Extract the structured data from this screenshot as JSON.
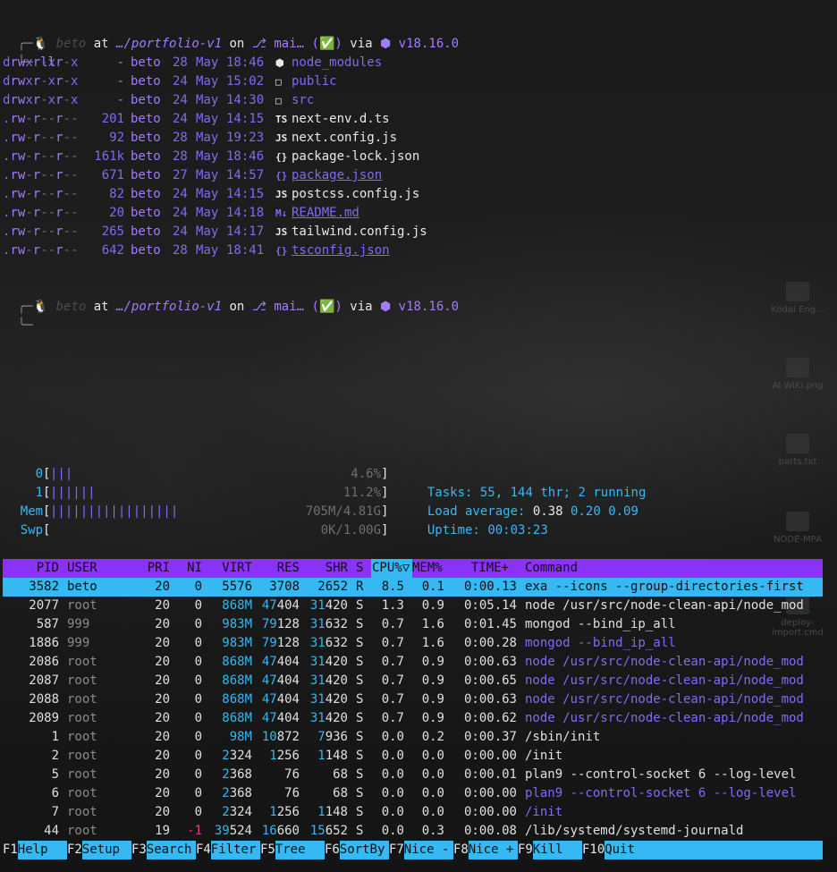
{
  "prompt": {
    "symbol": "╰─",
    "user": "beto",
    "at": "at",
    "path": "…/portfolio-v1",
    "on": "on",
    "branch_icon": "⎇",
    "branch": "mai…",
    "status": "(✅)",
    "via": "via",
    "node_version": "v18.16.0",
    "command": "ll"
  },
  "listing": [
    {
      "perm": "drwxr-xr-x",
      "size": "-",
      "user": "beto",
      "day": "28",
      "month": "May",
      "time": "18:46",
      "icon": "⬢",
      "name": "node_modules",
      "link": false,
      "color": "#7f6cf2"
    },
    {
      "perm": "drwxr-xr-x",
      "size": "-",
      "user": "beto",
      "day": "24",
      "month": "May",
      "time": "15:02",
      "icon": "□",
      "name": "public",
      "link": false,
      "color": "#7f6cf2"
    },
    {
      "perm": "drwxr-xr-x",
      "size": "-",
      "user": "beto",
      "day": "24",
      "month": "May",
      "time": "14:30",
      "icon": "□",
      "name": "src",
      "link": false,
      "color": "#7f6cf2"
    },
    {
      "perm": ".rw-r--r--",
      "size": "201",
      "user": "beto",
      "day": "24",
      "month": "May",
      "time": "14:15",
      "icon": "TS",
      "name": "next-env.d.ts",
      "link": false,
      "color": "#e8e8e8"
    },
    {
      "perm": ".rw-r--r--",
      "size": "92",
      "user": "beto",
      "day": "28",
      "month": "May",
      "time": "19:23",
      "icon": "JS",
      "name": "next.config.js",
      "link": false,
      "color": "#e8e8e8"
    },
    {
      "perm": ".rw-r--r--",
      "size": "161k",
      "user": "beto",
      "day": "28",
      "month": "May",
      "time": "18:46",
      "icon": "{}",
      "name": "package-lock.json",
      "link": false,
      "color": "#e8e8e8"
    },
    {
      "perm": ".rw-r--r--",
      "size": "671",
      "user": "beto",
      "day": "27",
      "month": "May",
      "time": "14:57",
      "icon": "{}",
      "name": "package.json",
      "link": true,
      "color": "#7f6cf2"
    },
    {
      "perm": ".rw-r--r--",
      "size": "82",
      "user": "beto",
      "day": "24",
      "month": "May",
      "time": "14:15",
      "icon": "JS",
      "name": "postcss.config.js",
      "link": false,
      "color": "#e8e8e8"
    },
    {
      "perm": ".rw-r--r--",
      "size": "20",
      "user": "beto",
      "day": "24",
      "month": "May",
      "time": "14:18",
      "icon": "M↓",
      "name": "README.md",
      "link": true,
      "color": "#7f6cf2"
    },
    {
      "perm": ".rw-r--r--",
      "size": "265",
      "user": "beto",
      "day": "24",
      "month": "May",
      "time": "14:17",
      "icon": "JS",
      "name": "tailwind.config.js",
      "link": false,
      "color": "#e8e8e8"
    },
    {
      "perm": ".rw-r--r--",
      "size": "642",
      "user": "beto",
      "day": "28",
      "month": "May",
      "time": "18:41",
      "icon": "{}",
      "name": "tsconfig.json",
      "link": true,
      "color": "#7f6cf2"
    }
  ],
  "htop": {
    "meters": [
      {
        "label": "0",
        "bars": "|||",
        "value": "4.6%"
      },
      {
        "label": "1",
        "bars": "||||||",
        "value": "11.2%"
      },
      {
        "label": "Mem",
        "bars": "|||||||||||||||||",
        "value": "705M/4.81G"
      },
      {
        "label": "Swp",
        "bars": "",
        "value": "0K/1.00G"
      }
    ],
    "tasks_label": "Tasks:",
    "tasks": "55,",
    "thr": "144",
    "thr_label": "thr;",
    "running": "2",
    "running_label": "running",
    "load_label": "Load average:",
    "load1": "0.38",
    "load5": "0.20",
    "load15": "0.09",
    "uptime_label": "Uptime:",
    "uptime": "00:03:23",
    "columns": [
      "PID",
      "USER",
      "PRI",
      "NI",
      "VIRT",
      "RES",
      "SHR",
      "S",
      "CPU%▽",
      "MEM%",
      "TIME+",
      "Command"
    ],
    "processes": [
      {
        "pid": "3582",
        "user": "beto",
        "pri": "20",
        "ni": "0",
        "virt": "5576",
        "res": "3708",
        "shr": "2652",
        "s": "R",
        "cpu": "8.5",
        "mem": "0.1",
        "time": "0:00.13",
        "cmd": "exa --icons --group-directories-first",
        "thread": false
      },
      {
        "pid": "2077",
        "user": "root",
        "pri": "20",
        "ni": "0",
        "virt": "868M",
        "res": "47404",
        "shr": "31420",
        "s": "S",
        "cpu": "1.3",
        "mem": "0.9",
        "time": "0:05.14",
        "cmd": "node /usr/src/node-clean-api/node_mod",
        "thread": false
      },
      {
        "pid": "587",
        "user": "999",
        "pri": "20",
        "ni": "0",
        "virt": "983M",
        "res": "79128",
        "shr": "31632",
        "s": "S",
        "cpu": "0.7",
        "mem": "1.6",
        "time": "0:01.45",
        "cmd": "mongod --bind_ip_all",
        "thread": false
      },
      {
        "pid": "1886",
        "user": "999",
        "pri": "20",
        "ni": "0",
        "virt": "983M",
        "res": "79128",
        "shr": "31632",
        "s": "S",
        "cpu": "0.7",
        "mem": "1.6",
        "time": "0:00.28",
        "cmd": "mongod --bind_ip_all",
        "thread": true
      },
      {
        "pid": "2086",
        "user": "root",
        "pri": "20",
        "ni": "0",
        "virt": "868M",
        "res": "47404",
        "shr": "31420",
        "s": "S",
        "cpu": "0.7",
        "mem": "0.9",
        "time": "0:00.63",
        "cmd": "node /usr/src/node-clean-api/node_mod",
        "thread": true
      },
      {
        "pid": "2087",
        "user": "root",
        "pri": "20",
        "ni": "0",
        "virt": "868M",
        "res": "47404",
        "shr": "31420",
        "s": "S",
        "cpu": "0.7",
        "mem": "0.9",
        "time": "0:00.65",
        "cmd": "node /usr/src/node-clean-api/node_mod",
        "thread": true
      },
      {
        "pid": "2088",
        "user": "root",
        "pri": "20",
        "ni": "0",
        "virt": "868M",
        "res": "47404",
        "shr": "31420",
        "s": "S",
        "cpu": "0.7",
        "mem": "0.9",
        "time": "0:00.63",
        "cmd": "node /usr/src/node-clean-api/node_mod",
        "thread": true
      },
      {
        "pid": "2089",
        "user": "root",
        "pri": "20",
        "ni": "0",
        "virt": "868M",
        "res": "47404",
        "shr": "31420",
        "s": "S",
        "cpu": "0.7",
        "mem": "0.9",
        "time": "0:00.62",
        "cmd": "node /usr/src/node-clean-api/node_mod",
        "thread": true
      },
      {
        "pid": "1",
        "user": "root",
        "pri": "20",
        "ni": "0",
        "virt": "98M",
        "res": "10872",
        "shr": "7936",
        "s": "S",
        "cpu": "0.0",
        "mem": "0.2",
        "time": "0:00.37",
        "cmd": "/sbin/init",
        "thread": false
      },
      {
        "pid": "2",
        "user": "root",
        "pri": "20",
        "ni": "0",
        "virt": "2324",
        "res": "1256",
        "shr": "1148",
        "s": "S",
        "cpu": "0.0",
        "mem": "0.0",
        "time": "0:00.00",
        "cmd": "/init",
        "thread": false
      },
      {
        "pid": "5",
        "user": "root",
        "pri": "20",
        "ni": "0",
        "virt": "2368",
        "res": "76",
        "shr": "68",
        "s": "S",
        "cpu": "0.0",
        "mem": "0.0",
        "time": "0:00.01",
        "cmd": "plan9 --control-socket 6 --log-level",
        "thread": false
      },
      {
        "pid": "6",
        "user": "root",
        "pri": "20",
        "ni": "0",
        "virt": "2368",
        "res": "76",
        "shr": "68",
        "s": "S",
        "cpu": "0.0",
        "mem": "0.0",
        "time": "0:00.00",
        "cmd": "plan9 --control-socket 6 --log-level",
        "thread": true
      },
      {
        "pid": "7",
        "user": "root",
        "pri": "20",
        "ni": "0",
        "virt": "2324",
        "res": "1256",
        "shr": "1148",
        "s": "S",
        "cpu": "0.0",
        "mem": "0.0",
        "time": "0:00.00",
        "cmd": "/init",
        "thread": true
      },
      {
        "pid": "44",
        "user": "root",
        "pri": "19",
        "ni": "-1",
        "virt": "39524",
        "res": "16660",
        "shr": "15652",
        "s": "S",
        "cpu": "0.0",
        "mem": "0.3",
        "time": "0:00.08",
        "cmd": "/lib/systemd/systemd-journald",
        "thread": false
      }
    ],
    "fkeys": [
      {
        "key": "F1",
        "label": "Help"
      },
      {
        "key": "F2",
        "label": "Setup"
      },
      {
        "key": "F3",
        "label": "Search"
      },
      {
        "key": "F4",
        "label": "Filter"
      },
      {
        "key": "F5",
        "label": "Tree"
      },
      {
        "key": "F6",
        "label": "SortBy"
      },
      {
        "key": "F7",
        "label": "Nice -"
      },
      {
        "key": "F8",
        "label": "Nice +"
      },
      {
        "key": "F9",
        "label": "Kill"
      },
      {
        "key": "F10",
        "label": "Quit"
      }
    ]
  },
  "desktop_icons": [
    {
      "label": "Kodai Eng..."
    },
    {
      "label": "AI WiKi.png"
    },
    {
      "label": "parts.txt"
    },
    {
      "label": "NODE-MPA"
    },
    {
      "label": "deploy-import.cmd"
    }
  ],
  "colors": {
    "accent_purple": "#7f6cf2",
    "header_bg": "#8a32f5",
    "selection_bg": "#36b8f3",
    "green": "#46c86b"
  }
}
